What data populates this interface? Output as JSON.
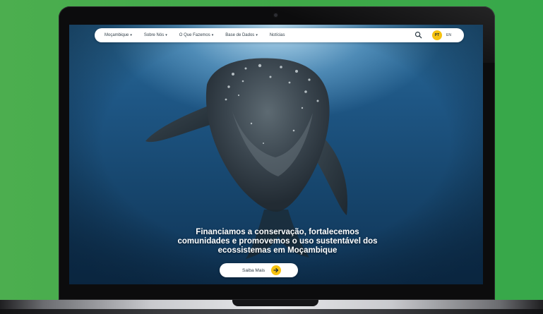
{
  "nav": {
    "items": [
      {
        "label": "Moçambique",
        "dropdown": true
      },
      {
        "label": "Sobre Nós",
        "dropdown": true
      },
      {
        "label": "O Que Fazemos",
        "dropdown": true
      },
      {
        "label": "Base de Dados",
        "dropdown": true
      },
      {
        "label": "Notícias",
        "dropdown": false
      }
    ],
    "search_icon": "search-icon",
    "lang_active": "PT",
    "lang_other": "EN"
  },
  "hero": {
    "headline_lines": [
      "Financiamos a conservação, fortalecemos",
      "comunidades e promovemos o uso sustentável dos",
      "ecossistemas em Moçambique"
    ],
    "cta_label": "Saiba Mais",
    "cta_icon": "arrow-right-icon"
  },
  "colors": {
    "background_green": "#3fa848",
    "accent_yellow": "#f6c20f",
    "water_blue": "#1e5684"
  }
}
